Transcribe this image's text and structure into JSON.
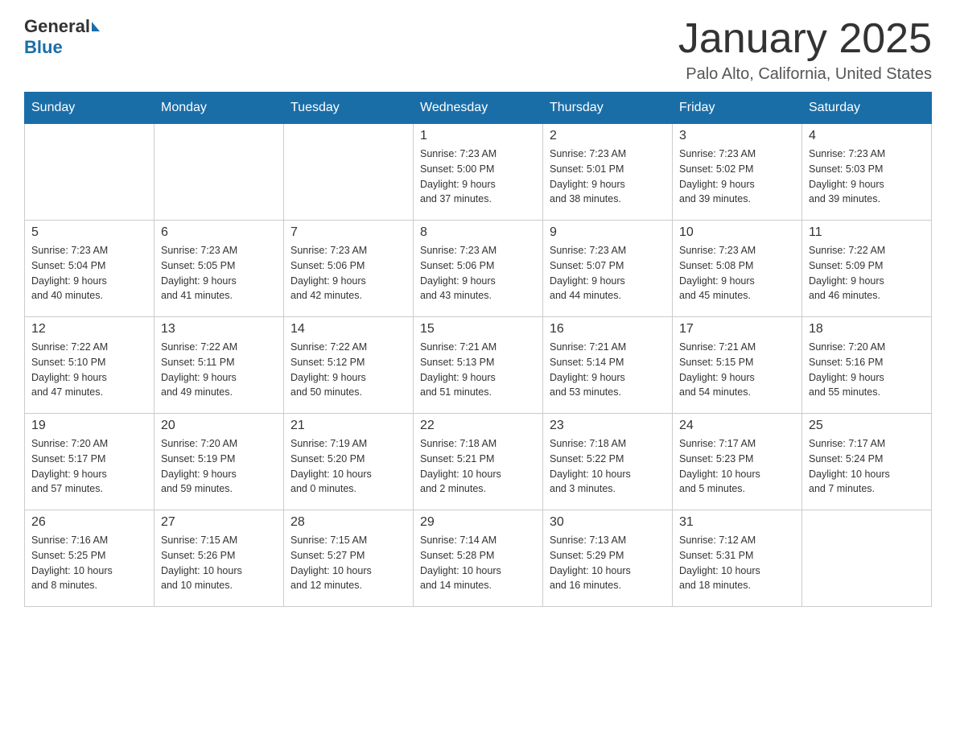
{
  "header": {
    "logo": {
      "general": "General",
      "blue": "Blue"
    },
    "title": "January 2025",
    "location": "Palo Alto, California, United States"
  },
  "weekdays": [
    "Sunday",
    "Monday",
    "Tuesday",
    "Wednesday",
    "Thursday",
    "Friday",
    "Saturday"
  ],
  "weeks": [
    [
      {
        "day": "",
        "info": ""
      },
      {
        "day": "",
        "info": ""
      },
      {
        "day": "",
        "info": ""
      },
      {
        "day": "1",
        "info": "Sunrise: 7:23 AM\nSunset: 5:00 PM\nDaylight: 9 hours\nand 37 minutes."
      },
      {
        "day": "2",
        "info": "Sunrise: 7:23 AM\nSunset: 5:01 PM\nDaylight: 9 hours\nand 38 minutes."
      },
      {
        "day": "3",
        "info": "Sunrise: 7:23 AM\nSunset: 5:02 PM\nDaylight: 9 hours\nand 39 minutes."
      },
      {
        "day": "4",
        "info": "Sunrise: 7:23 AM\nSunset: 5:03 PM\nDaylight: 9 hours\nand 39 minutes."
      }
    ],
    [
      {
        "day": "5",
        "info": "Sunrise: 7:23 AM\nSunset: 5:04 PM\nDaylight: 9 hours\nand 40 minutes."
      },
      {
        "day": "6",
        "info": "Sunrise: 7:23 AM\nSunset: 5:05 PM\nDaylight: 9 hours\nand 41 minutes."
      },
      {
        "day": "7",
        "info": "Sunrise: 7:23 AM\nSunset: 5:06 PM\nDaylight: 9 hours\nand 42 minutes."
      },
      {
        "day": "8",
        "info": "Sunrise: 7:23 AM\nSunset: 5:06 PM\nDaylight: 9 hours\nand 43 minutes."
      },
      {
        "day": "9",
        "info": "Sunrise: 7:23 AM\nSunset: 5:07 PM\nDaylight: 9 hours\nand 44 minutes."
      },
      {
        "day": "10",
        "info": "Sunrise: 7:23 AM\nSunset: 5:08 PM\nDaylight: 9 hours\nand 45 minutes."
      },
      {
        "day": "11",
        "info": "Sunrise: 7:22 AM\nSunset: 5:09 PM\nDaylight: 9 hours\nand 46 minutes."
      }
    ],
    [
      {
        "day": "12",
        "info": "Sunrise: 7:22 AM\nSunset: 5:10 PM\nDaylight: 9 hours\nand 47 minutes."
      },
      {
        "day": "13",
        "info": "Sunrise: 7:22 AM\nSunset: 5:11 PM\nDaylight: 9 hours\nand 49 minutes."
      },
      {
        "day": "14",
        "info": "Sunrise: 7:22 AM\nSunset: 5:12 PM\nDaylight: 9 hours\nand 50 minutes."
      },
      {
        "day": "15",
        "info": "Sunrise: 7:21 AM\nSunset: 5:13 PM\nDaylight: 9 hours\nand 51 minutes."
      },
      {
        "day": "16",
        "info": "Sunrise: 7:21 AM\nSunset: 5:14 PM\nDaylight: 9 hours\nand 53 minutes."
      },
      {
        "day": "17",
        "info": "Sunrise: 7:21 AM\nSunset: 5:15 PM\nDaylight: 9 hours\nand 54 minutes."
      },
      {
        "day": "18",
        "info": "Sunrise: 7:20 AM\nSunset: 5:16 PM\nDaylight: 9 hours\nand 55 minutes."
      }
    ],
    [
      {
        "day": "19",
        "info": "Sunrise: 7:20 AM\nSunset: 5:17 PM\nDaylight: 9 hours\nand 57 minutes."
      },
      {
        "day": "20",
        "info": "Sunrise: 7:20 AM\nSunset: 5:19 PM\nDaylight: 9 hours\nand 59 minutes."
      },
      {
        "day": "21",
        "info": "Sunrise: 7:19 AM\nSunset: 5:20 PM\nDaylight: 10 hours\nand 0 minutes."
      },
      {
        "day": "22",
        "info": "Sunrise: 7:18 AM\nSunset: 5:21 PM\nDaylight: 10 hours\nand 2 minutes."
      },
      {
        "day": "23",
        "info": "Sunrise: 7:18 AM\nSunset: 5:22 PM\nDaylight: 10 hours\nand 3 minutes."
      },
      {
        "day": "24",
        "info": "Sunrise: 7:17 AM\nSunset: 5:23 PM\nDaylight: 10 hours\nand 5 minutes."
      },
      {
        "day": "25",
        "info": "Sunrise: 7:17 AM\nSunset: 5:24 PM\nDaylight: 10 hours\nand 7 minutes."
      }
    ],
    [
      {
        "day": "26",
        "info": "Sunrise: 7:16 AM\nSunset: 5:25 PM\nDaylight: 10 hours\nand 8 minutes."
      },
      {
        "day": "27",
        "info": "Sunrise: 7:15 AM\nSunset: 5:26 PM\nDaylight: 10 hours\nand 10 minutes."
      },
      {
        "day": "28",
        "info": "Sunrise: 7:15 AM\nSunset: 5:27 PM\nDaylight: 10 hours\nand 12 minutes."
      },
      {
        "day": "29",
        "info": "Sunrise: 7:14 AM\nSunset: 5:28 PM\nDaylight: 10 hours\nand 14 minutes."
      },
      {
        "day": "30",
        "info": "Sunrise: 7:13 AM\nSunset: 5:29 PM\nDaylight: 10 hours\nand 16 minutes."
      },
      {
        "day": "31",
        "info": "Sunrise: 7:12 AM\nSunset: 5:31 PM\nDaylight: 10 hours\nand 18 minutes."
      },
      {
        "day": "",
        "info": ""
      }
    ]
  ]
}
